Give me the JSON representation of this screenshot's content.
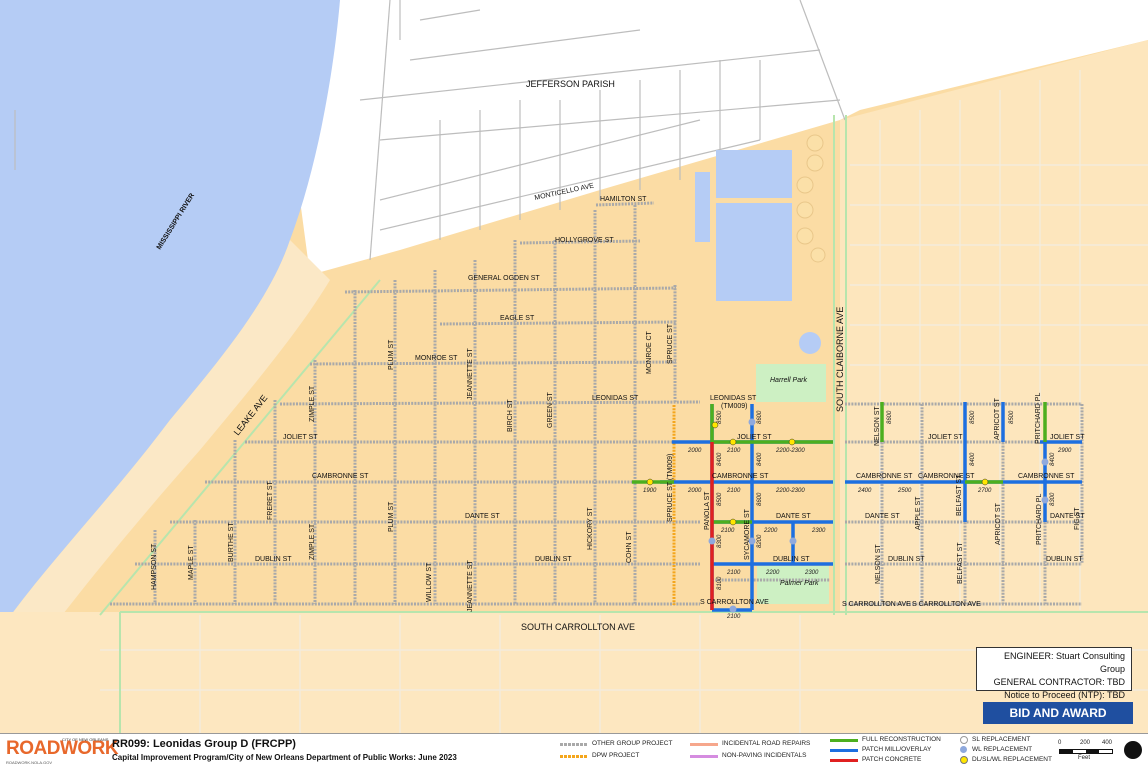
{
  "map_labels": {
    "river": "MISSISSIPPI RIVER",
    "jefferson": "JEFFERSON PARISH",
    "monticello": "MONTICELLO AVE",
    "hamilton": "HAMILTON ST",
    "hollygrove": "HOLLYGROVE ST",
    "general_ogden": "GENERAL OGDEN ST",
    "eagle": "EAGLE ST",
    "monroe": "MONROE ST",
    "leonidas": "LEONIDAS ST",
    "leonidas_e": "LEONIDAS ST",
    "tm009": "(TM009)",
    "joliet_w": "JOLIET ST",
    "joliet_c": "JOLIET ST",
    "joliet_e1": "JOLIET ST",
    "joliet_e2": "JOLIET ST",
    "cambronne_w": "CAMBRONNE ST",
    "cambronne_c": "CAMBRONNE ST",
    "cambronne_e1": "CAMBRONNE ST",
    "cambronne_e2": "CAMBRONNE ST",
    "cambronne_e3": "CAMBRONNE ST",
    "dante_w": "DANTE ST",
    "dante_c": "DANTE ST",
    "dante_e1": "DANTE ST",
    "dante_e2": "DANTE ST",
    "dublin_w": "DUBLIN ST",
    "dublin_w2": "DUBLIN ST",
    "dublin_c": "DUBLIN ST",
    "dublin_e1": "DUBLIN ST",
    "dublin_e2": "DUBLIN ST",
    "s_carrollton_1": "S CARROLLTON AVE",
    "s_carrollton_2": "S CARROLLTON AVE",
    "s_carrollton_3": "S CARROLLTON AVE",
    "south_carrollton": "SOUTH CARROLLTON AVE",
    "south_claiborne": "SOUTH CLAIBORNE AVE",
    "leake": "LEAKE AVE",
    "harrell_park": "Harrell Park",
    "palmer_park": "Palmer Park",
    "monroe_ct": "MONROE CT",
    "spruce_n": "SPRUCE ST",
    "spruce_s": "SPRUCE ST (TM009)",
    "panola": "PANOLA ST",
    "sycamore": "SYCAMORE ST",
    "birch": "BIRCH ST",
    "green": "GREEN ST",
    "hickory": "HICKORY ST",
    "cohn": "COHN ST",
    "plum_n": "PLUM ST",
    "plum_s": "PLUM ST",
    "jeannette_n": "JEANNETTE ST",
    "jeannette_s": "JEANNETTE ST",
    "zimpel_n": "ZIMPLE ST",
    "zimpel_s": "ZIMPLE ST",
    "fern": "FRERET ST",
    "burthe": "BURTHE ST",
    "maple": "MAPLE ST",
    "hampson": "HAMPSON ST",
    "willow": "WILLOW ST",
    "nelson_n": "NELSON ST",
    "nelson_s": "NELSON ST",
    "apple": "APPLE ST",
    "belfast_n": "BELFAST ST",
    "belfast_s": "BELFAST ST",
    "belfast_c": "BELFAST ST",
    "apricot_n": "APRICOT ST",
    "apricot_s": "APRICOT ST",
    "pritchard_n": "PRITCHARD PL",
    "pritchard_s": "PRITCHARD PL",
    "fig": "FIG ST",
    "blocks": [
      "2000",
      "2100",
      "2200-2300",
      "8400",
      "8500",
      "8600",
      "1900",
      "2000",
      "2100",
      "2200-2300",
      "8400",
      "8500",
      "8600",
      "2100",
      "2200",
      "2300",
      "8300",
      "8200",
      "2100",
      "2200",
      "2300",
      "8100",
      "2100",
      "2400",
      "2500",
      "2700",
      "8400",
      "8500",
      "2900",
      "8500",
      "8600",
      "8400",
      "8300"
    ]
  },
  "info": {
    "engineer": "ENGINEER:  Stuart Consulting Group",
    "contractor": "GENERAL CONTRACTOR: TBD",
    "ntp": "Notice to Proceed (NTP): TBD"
  },
  "status": "BID AND AWARD",
  "footer": {
    "logo": "ROADWORK",
    "logo_sub": "ROADWORK.NOLA.GOV",
    "city": "CITY OF NEW ORLEANS",
    "title": "RR099:  Leonidas Group D (FRCPP)",
    "subtitle": "Capital Improvement Program/City of New Orleans Department of Public Works:  June 2023"
  },
  "legend": {
    "other_group": "OTHER GROUP PROJECT",
    "dpw": "DPW PROJECT",
    "incidental": "INCIDENTAL ROAD REPAIRS",
    "non_paving": "NON-PAVING INCIDENTALS",
    "full_recon": "FULL RECONSTRUCTION",
    "patch_mill": "PATCH MILL/OVERLAY",
    "patch_concrete": "PATCH CONCRETE",
    "sl": "SL REPLACEMENT",
    "wl": "WL REPLACEMENT",
    "dl": "DL/SL/WL REPLACEMENT",
    "scale_0": "0",
    "scale_200": "200",
    "scale_400": "400",
    "scale_unit": "Feet"
  },
  "colors": {
    "land": "#fbdca4",
    "river": "#b5ccf5",
    "outside": "#ffffff",
    "other_group": "#a9a9a9",
    "dpw": "#f4a61c",
    "full_recon": "#4caf1f",
    "patch_mill": "#1d6fe0",
    "patch_concrete": "#e02020",
    "status_bg": "#1f4fa0"
  }
}
